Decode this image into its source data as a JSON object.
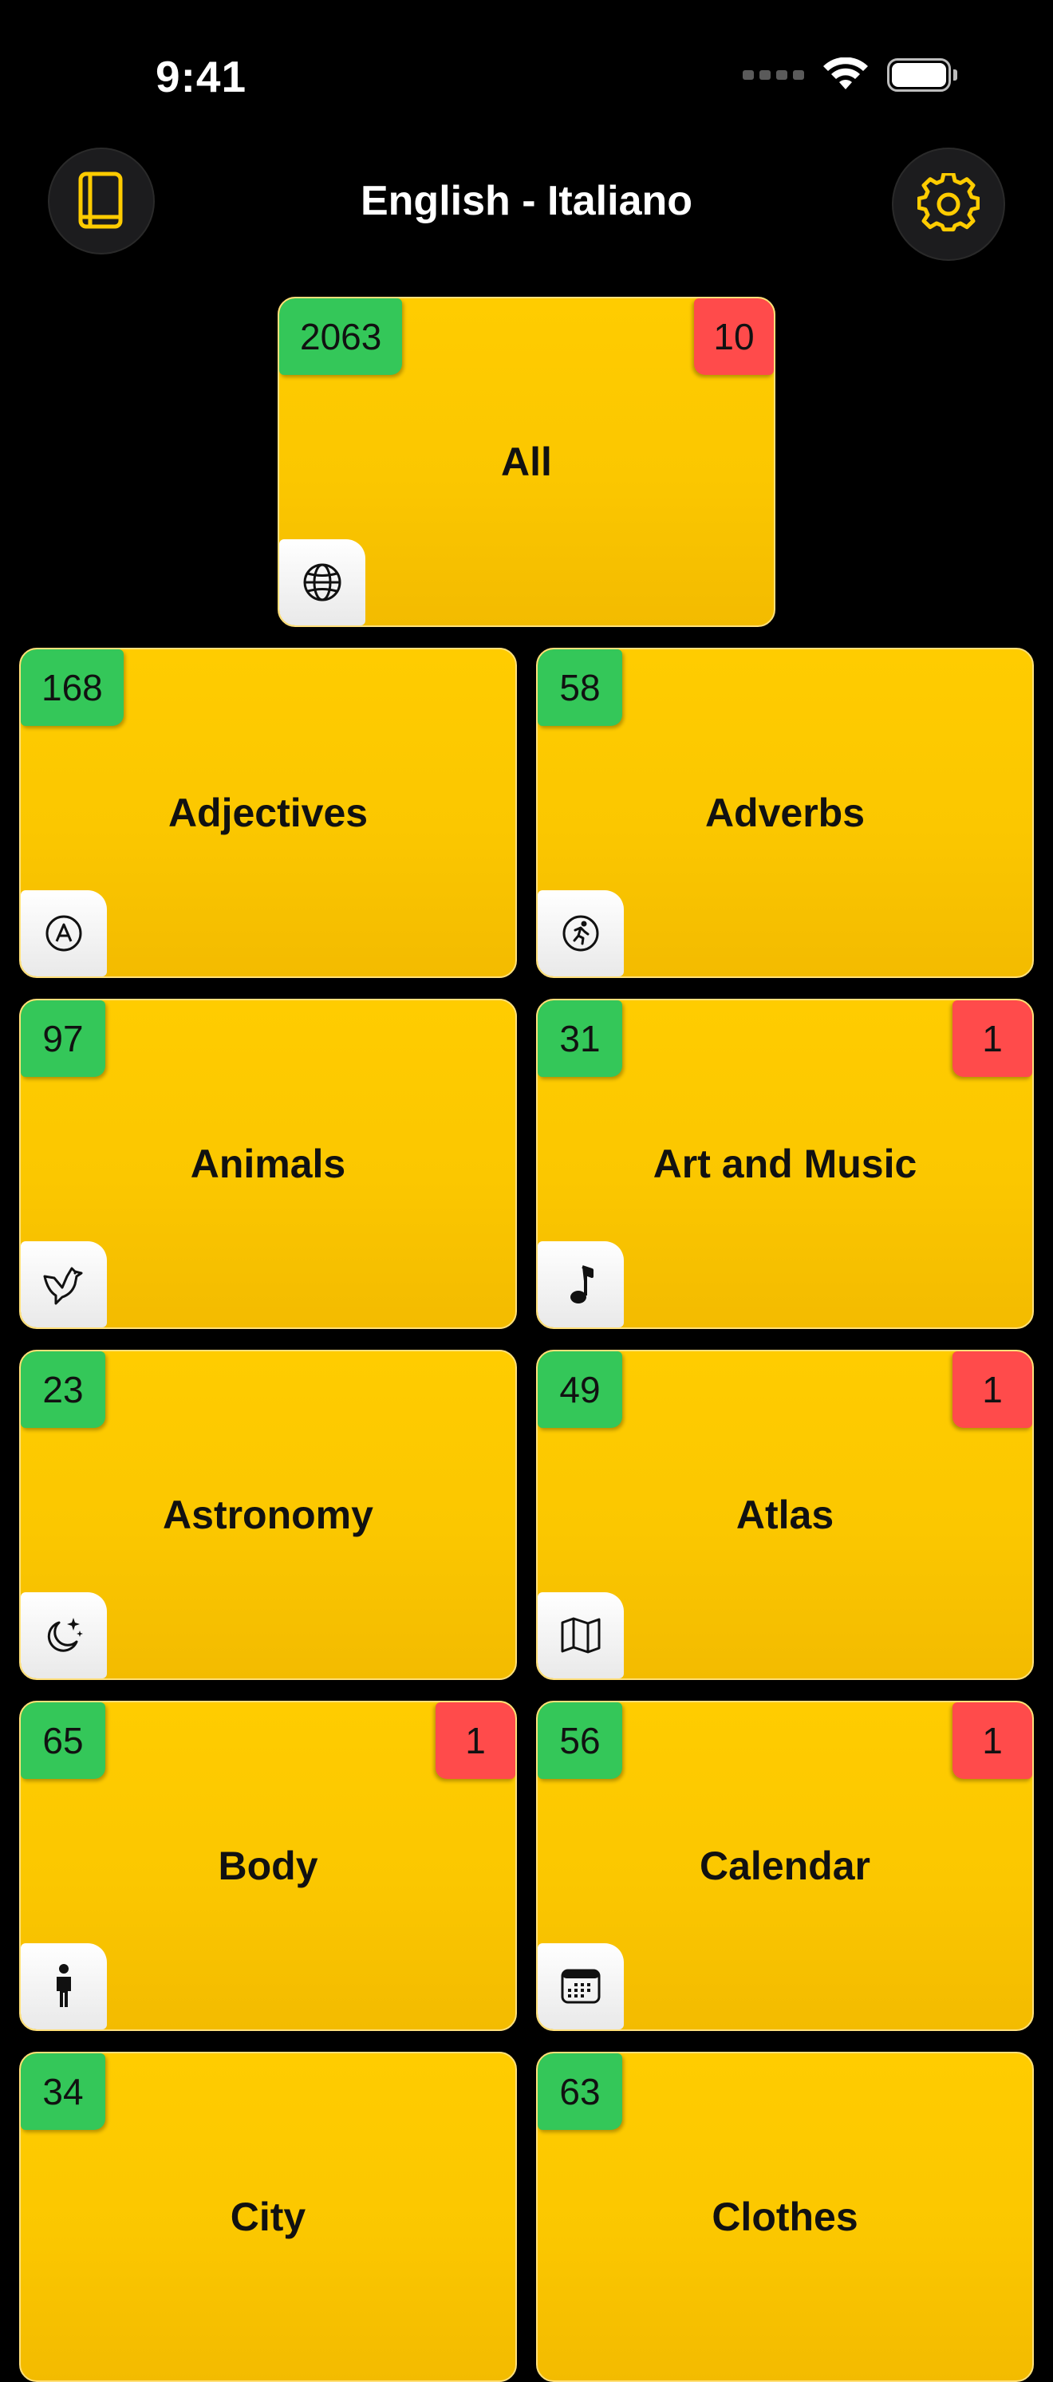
{
  "status_bar": {
    "time": "9:41"
  },
  "header": {
    "title": "English - Italiano",
    "left_icon": "book-icon",
    "right_icon": "gear-icon",
    "accent_color": "#ffcc00"
  },
  "colors": {
    "tile": "#ffcc00",
    "count_badge": "#34c759",
    "alert_badge": "#ff4b4b",
    "background": "#000000"
  },
  "all_tile": {
    "label": "All",
    "count": "2063",
    "alerts": "10",
    "icon": "globe-icon"
  },
  "categories": [
    {
      "label": "Adjectives",
      "count": "168",
      "alerts": "",
      "icon": "letter-a-circle-icon"
    },
    {
      "label": "Adverbs",
      "count": "58",
      "alerts": "",
      "icon": "running-figure-circle-icon"
    },
    {
      "label": "Animals",
      "count": "97",
      "alerts": "",
      "icon": "bird-icon"
    },
    {
      "label": "Art and Music",
      "count": "31",
      "alerts": "1",
      "icon": "music-note-icon"
    },
    {
      "label": "Astronomy",
      "count": "23",
      "alerts": "",
      "icon": "moon-stars-icon"
    },
    {
      "label": "Atlas",
      "count": "49",
      "alerts": "1",
      "icon": "map-icon"
    },
    {
      "label": "Body",
      "count": "65",
      "alerts": "1",
      "icon": "person-icon"
    },
    {
      "label": "Calendar",
      "count": "56",
      "alerts": "1",
      "icon": "calendar-icon"
    },
    {
      "label": "City",
      "count": "34",
      "alerts": "",
      "icon": ""
    },
    {
      "label": "Clothes",
      "count": "63",
      "alerts": "",
      "icon": ""
    }
  ]
}
